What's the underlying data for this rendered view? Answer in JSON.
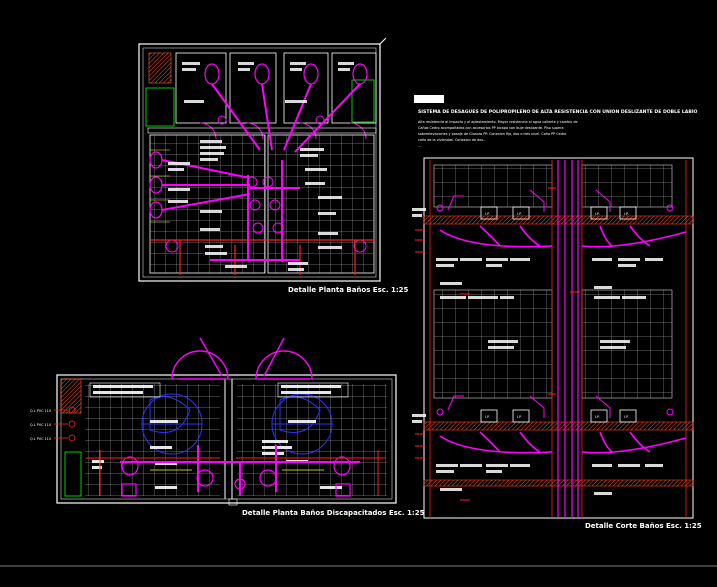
{
  "captions": {
    "plan_banos": "Detalle Planta Baños Esc. 1:25",
    "plan_discapacitados": "Detalle Planta Baños Discapacitados Esc. 1:25",
    "corte_banos": "Detalle Corte Baños Esc. 1:25"
  },
  "note": {
    "badge": "",
    "title": "SISTEMA DE DESAGUES DE POLIPROPILENO DE ALTA RESISTENCIA CON UNION DESLIZANTE DE DOBLE LABIO",
    "lines": [
      "Alta resistencia al impacto y al aplastamiento. Mayor resistencia al agua caliente y cambio de",
      "Caños Cedro acompañados con accesorios PP bicapa con buje deslizante. Piso supera",
      "sobreelevaciones y pasaje de Cloacas PP. Conexion fija, dos o tres nivel. Caño PP Cedro",
      "caño de la viviendas. Conexion de dos...",
      "..."
    ]
  },
  "labels": {
    "inodoro": "I.P.",
    "pvc": "Q.L PVC 110"
  },
  "colors": {
    "background": "#000000",
    "walls": "#ffffff",
    "fixtures": "#ff00ff",
    "pipes_red": "#ff2020",
    "pipes_yellow": "#ffff00",
    "pipes_blue": "#3030ff",
    "green": "#00ff00",
    "hatch": "#ff4000",
    "tile_grid": "#d0d0d0"
  }
}
